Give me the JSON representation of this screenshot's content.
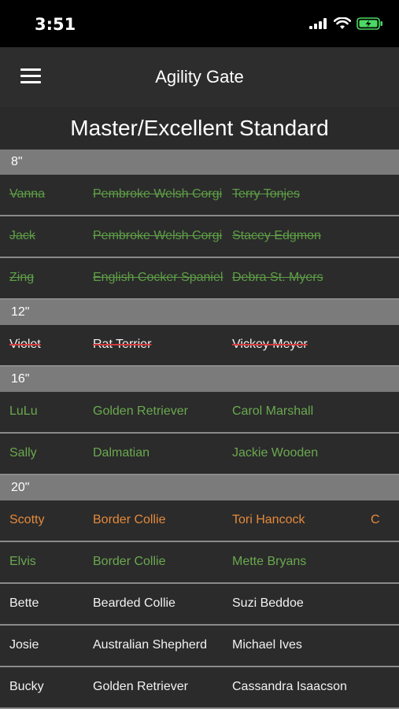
{
  "status": {
    "time": "3:51"
  },
  "nav": {
    "title": "Agility Gate"
  },
  "class_title": "Master/Excellent Standard",
  "sections": [
    {
      "height": "8\"",
      "entries": [
        {
          "dog": "Vanna",
          "breed": "Pembroke Welsh Corgi",
          "handler": "Terry Tonjes",
          "extra": "",
          "style": "scratch-green"
        },
        {
          "dog": "Jack",
          "breed": "Pembroke Welsh Corgi",
          "handler": "Stacey Edgmon",
          "extra": "",
          "style": "scratch-green"
        },
        {
          "dog": "Zing",
          "breed": "English Cocker Spaniel",
          "handler": "Debra St. Myers",
          "extra": "",
          "style": "scratch-green"
        }
      ]
    },
    {
      "height": "12\"",
      "entries": [
        {
          "dog": "Violet",
          "breed": "Rat Terrier",
          "handler": "Vickey Meyer",
          "extra": "",
          "style": "scratch-white"
        }
      ]
    },
    {
      "height": "16\"",
      "entries": [
        {
          "dog": "LuLu",
          "breed": "Golden Retriever",
          "handler": "Carol Marshall",
          "extra": "",
          "style": "green"
        },
        {
          "dog": "Sally",
          "breed": "Dalmatian",
          "handler": "Jackie Wooden",
          "extra": "",
          "style": "green"
        }
      ]
    },
    {
      "height": "20\"",
      "entries": [
        {
          "dog": "Scotty",
          "breed": "Border Collie",
          "handler": "Tori Hancock",
          "extra": "C",
          "style": "orange"
        },
        {
          "dog": "Elvis",
          "breed": "Border Collie",
          "handler": "Mette Bryans",
          "extra": "",
          "style": "green"
        },
        {
          "dog": "Bette",
          "breed": "Bearded Collie",
          "handler": "Suzi Beddoe",
          "extra": "",
          "style": "white"
        },
        {
          "dog": "Josie",
          "breed": "Australian Shepherd",
          "handler": "Michael Ives",
          "extra": "",
          "style": "white"
        },
        {
          "dog": "Bucky",
          "breed": "Golden Retriever",
          "handler": "Cassandra Isaacson",
          "extra": "",
          "style": "white"
        }
      ]
    }
  ],
  "colors": {
    "green": "#6aa94f",
    "orange": "#e48a3c",
    "header_gray": "#7b7b7b",
    "background": "#2b2b2b",
    "scratch_line_red": "#d23b3b",
    "battery_green": "#4cd964"
  },
  "icons": [
    "cellular-signal-icon",
    "wifi-icon",
    "battery-charging-icon",
    "hamburger-menu-icon"
  ]
}
